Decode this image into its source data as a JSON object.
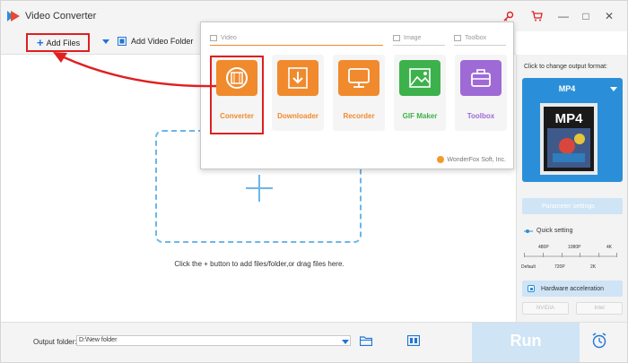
{
  "app": {
    "title": "Video Converter"
  },
  "colors": {
    "accent": "#1e75d8",
    "annotation": "#e01f1f",
    "panel_blue": "#2a8fd8"
  },
  "icons": [
    "app-logo-icon",
    "key-icon",
    "cart-icon",
    "plus-icon",
    "folder-icon",
    "film-icon",
    "download-icon",
    "monitor-icon",
    "image-icon",
    "toolbox-icon",
    "clip-icon",
    "alarm-icon"
  ],
  "toolbar": {
    "add_files": "Add Files",
    "add_folder": "Add Video Folder"
  },
  "popup": {
    "sections": {
      "video": "Video",
      "image": "Image",
      "toolbox": "Toolbox"
    },
    "tiles": [
      {
        "label": "Converter",
        "color": "#f08a2d"
      },
      {
        "label": "Downloader",
        "color": "#f08a2d"
      },
      {
        "label": "Recorder",
        "color": "#f08a2d"
      },
      {
        "label": "GIF Maker",
        "color": "#3db14b"
      },
      {
        "label": "Toolbox",
        "color": "#9e6ad6"
      }
    ],
    "brand": "WonderFox Soft, Inc."
  },
  "main": {
    "hint": "Click the + button to add files/folder,or drag files here."
  },
  "right_panel": {
    "label": "Click to change output format:",
    "format": "MP4",
    "format_art_text": "MP4",
    "param_settings": "Parameter settings",
    "quick_setting": "Quick setting",
    "slider_top": [
      "480P",
      "1080P",
      "4K"
    ],
    "slider_bottom": [
      "Default",
      "720P",
      "2K"
    ],
    "slider_level_fraction": 0.0,
    "hw_accel": "Hardware acceleration",
    "gpu": [
      "NVIDIA",
      "Intel"
    ]
  },
  "bottom": {
    "output_label": "Output folder:",
    "output_value": "D:\\New folder",
    "run": "Run"
  }
}
